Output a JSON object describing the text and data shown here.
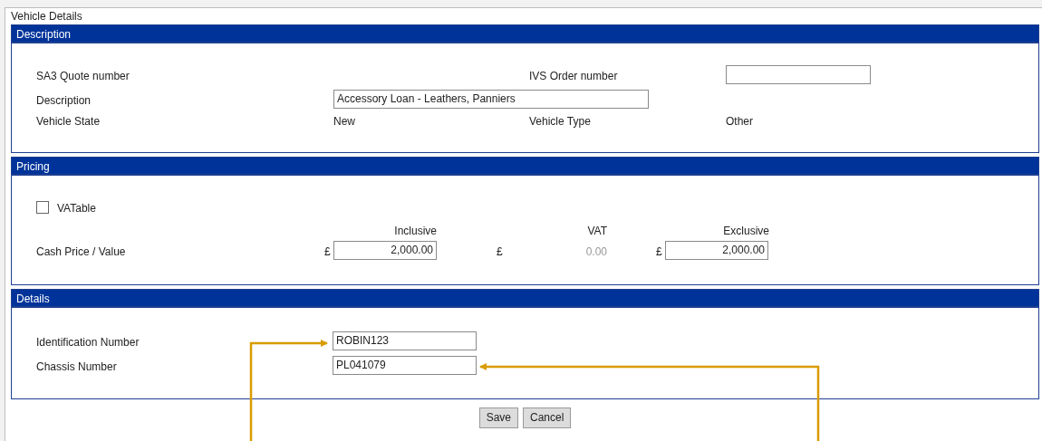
{
  "title": "Vehicle Details",
  "description": {
    "header": "Description",
    "sa3_quote_label": "SA3 Quote number",
    "ivs_order_label": "IVS Order number",
    "description_label": "Description",
    "description_value": "Accessory Loan - Leathers, Panniers",
    "vehicle_state_label": "Vehicle State",
    "vehicle_state_value": "New",
    "vehicle_type_label": "Vehicle Type",
    "vehicle_type_value": "Other"
  },
  "pricing": {
    "header": "Pricing",
    "vatable": {
      "label": "VATable",
      "checked": false
    },
    "columns": [
      "Inclusive",
      "VAT",
      "Exclusive"
    ],
    "cash_price": {
      "label": "Cash Price / Value",
      "cells": [
        {
          "kind": "input",
          "currency": "£",
          "value": "2,000.00"
        },
        {
          "kind": "readonly",
          "currency": "£",
          "value": "0.00"
        },
        {
          "kind": "input",
          "currency": "£",
          "value": "2,000.00"
        }
      ]
    }
  },
  "details": {
    "header": "Details",
    "fields": [
      {
        "label": "Identification Number",
        "value": "ROBIN123"
      },
      {
        "label": "Chassis Number",
        "value": "PL041079"
      }
    ]
  },
  "buttons": [
    "Save",
    "Cancel"
  ]
}
